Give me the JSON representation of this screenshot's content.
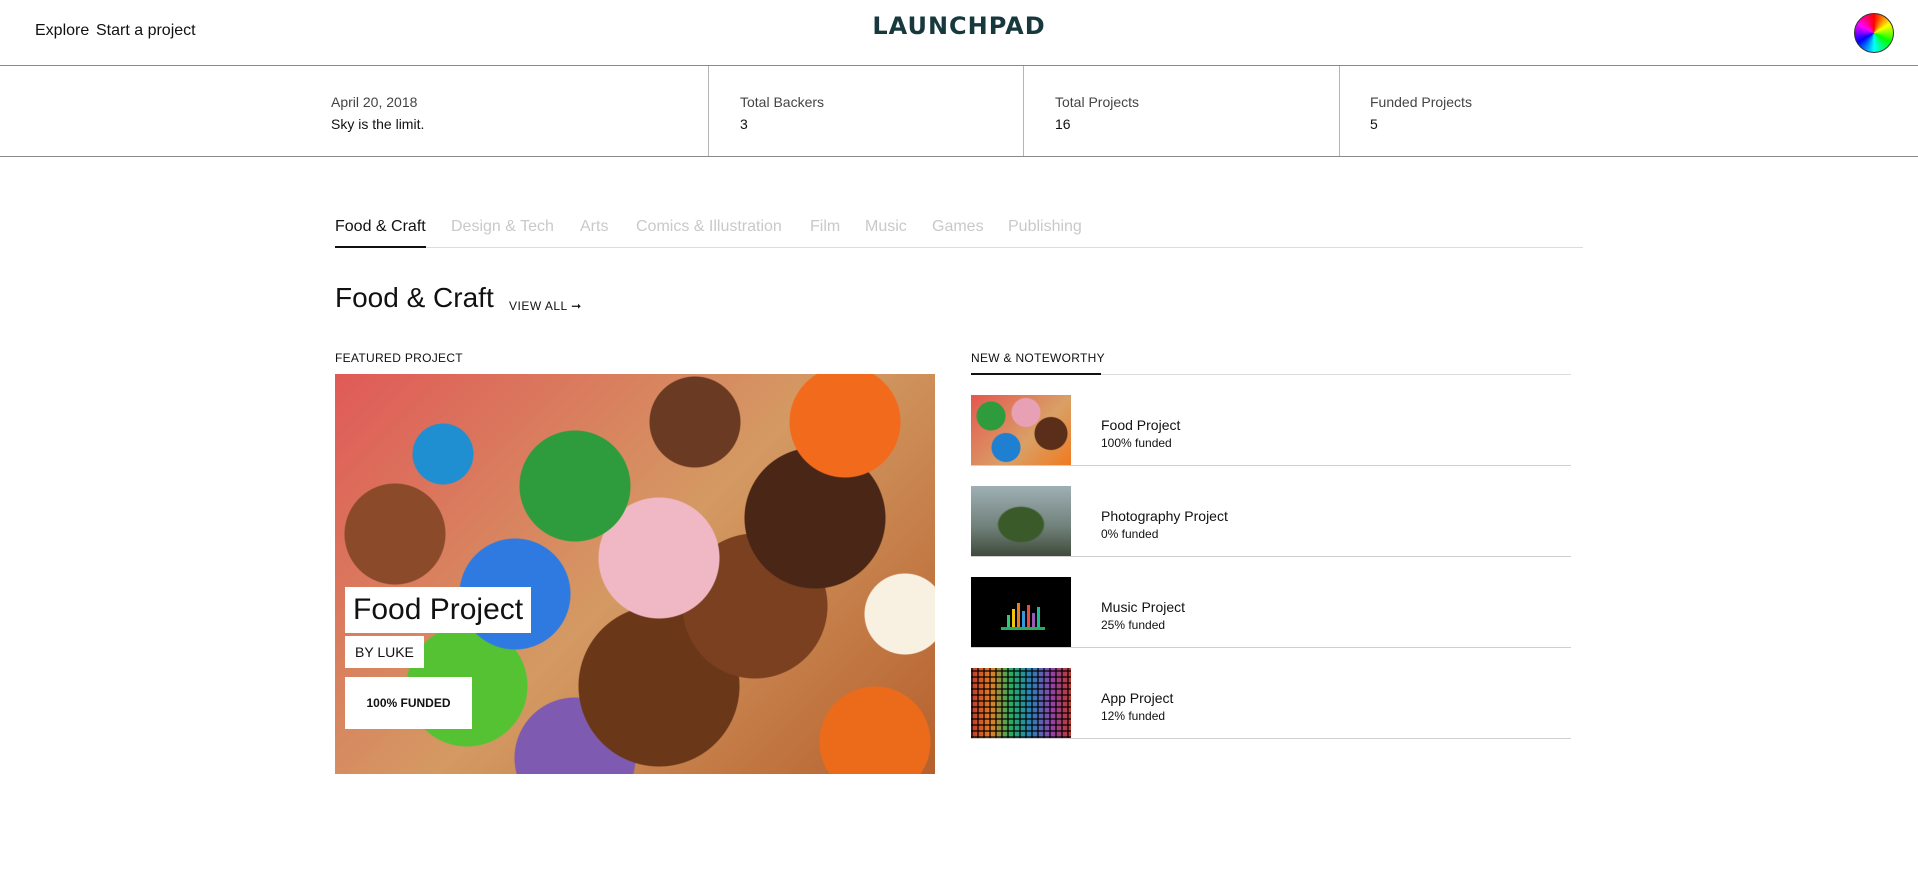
{
  "nav": {
    "explore": "Explore",
    "start_project": "Start a project",
    "logo": "LAUNCHPAD"
  },
  "stats": {
    "date": "April 20, 2018",
    "tagline": "Sky is the limit.",
    "total_backers_label": "Total Backers",
    "total_backers_value": "3",
    "total_projects_label": "Total Projects",
    "total_projects_value": "16",
    "funded_projects_label": "Funded Projects",
    "funded_projects_value": "5"
  },
  "tabs": [
    {
      "label": "Food & Craft",
      "active": true
    },
    {
      "label": "Design & Tech",
      "active": false
    },
    {
      "label": "Arts",
      "active": false
    },
    {
      "label": "Comics & Illustration",
      "active": false
    },
    {
      "label": "Film",
      "active": false
    },
    {
      "label": "Music",
      "active": false
    },
    {
      "label": "Games",
      "active": false
    },
    {
      "label": "Publishing",
      "active": false
    }
  ],
  "section": {
    "title": "Food & Craft",
    "view_all": "VIEW ALL ➞"
  },
  "featured": {
    "heading": "FEATURED PROJECT",
    "title": "Food Project",
    "by": "BY LUKE",
    "funded": "100% FUNDED"
  },
  "noteworthy": {
    "heading": "NEW & NOTEWORTHY",
    "items": [
      {
        "title": "Food Project",
        "funded": "100% funded"
      },
      {
        "title": "Photography Project",
        "funded": "0% funded"
      },
      {
        "title": "Music Project",
        "funded": "25% funded"
      },
      {
        "title": "App Project",
        "funded": "12% funded"
      }
    ]
  }
}
